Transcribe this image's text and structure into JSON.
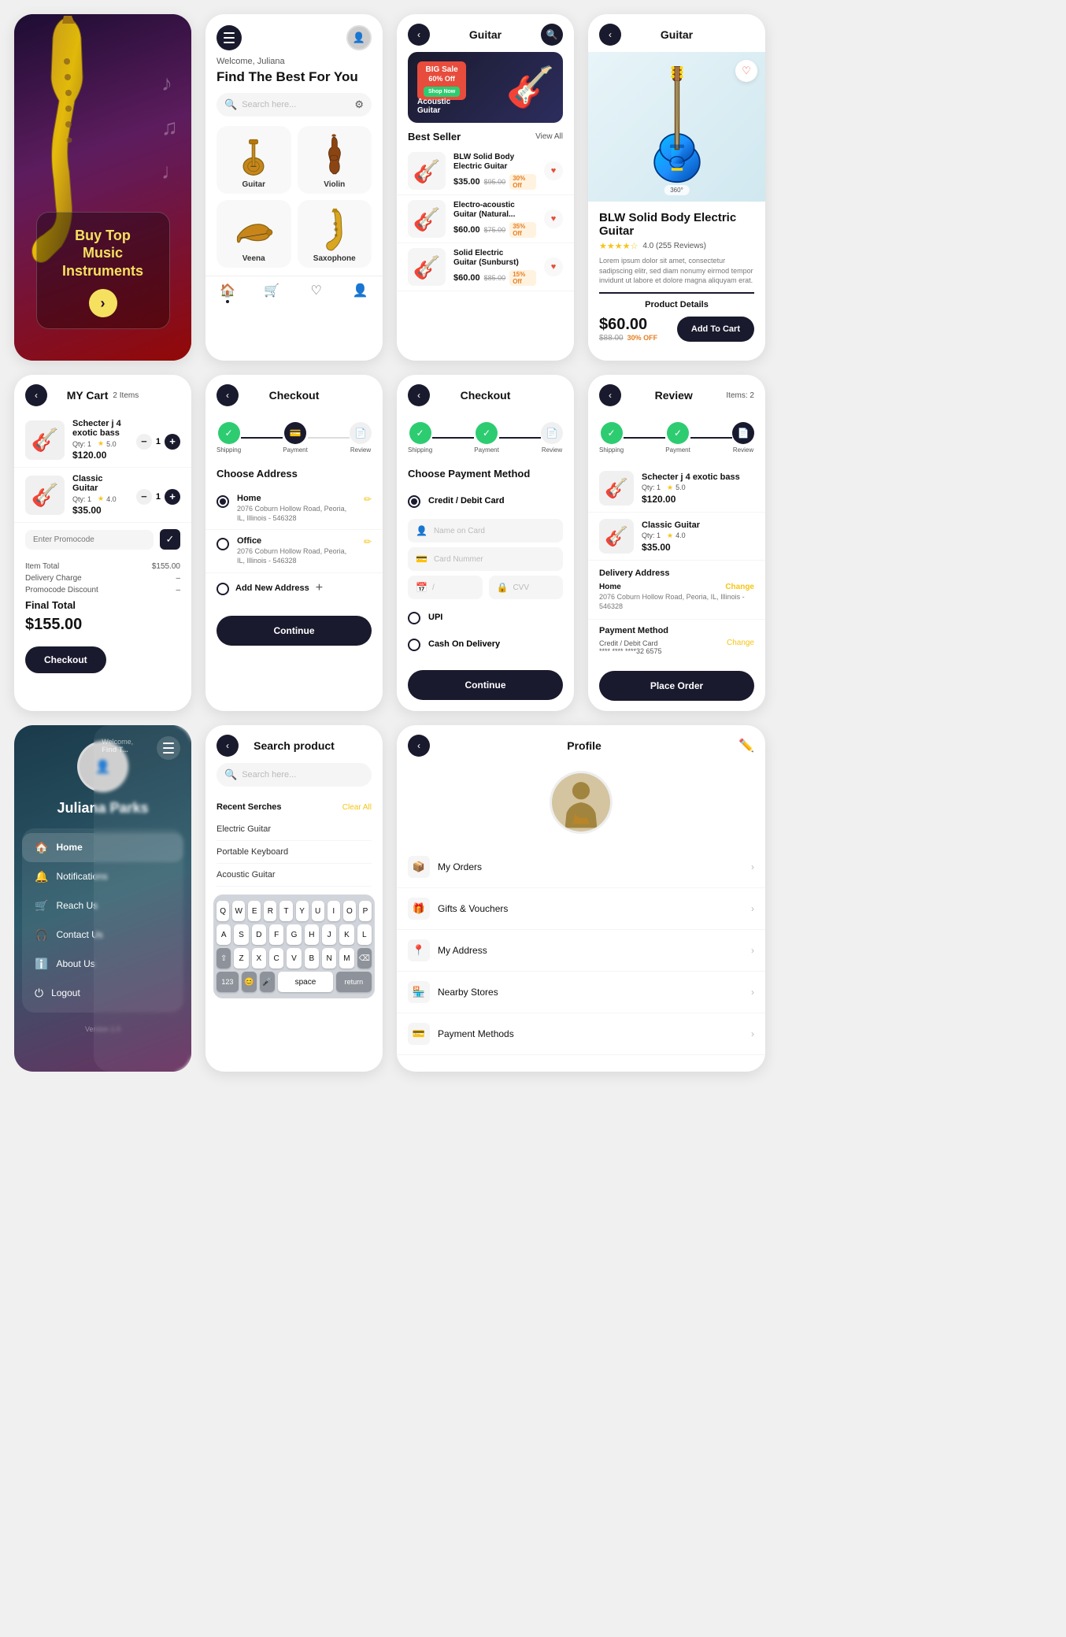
{
  "splash": {
    "title": "Buy Top Music Instruments",
    "btn_arrow": "›",
    "notes": "♪\n♫\n♩"
  },
  "home": {
    "welcome": "Welcome, Juliana",
    "find_text": "Find The Best For You",
    "search_placeholder": "Search here...",
    "categories": [
      {
        "name": "Guitar",
        "icon": "🎸"
      },
      {
        "name": "Violin",
        "icon": "🎻"
      },
      {
        "name": "Veena",
        "icon": "🪕"
      },
      {
        "name": "Saxophone",
        "icon": "🎷"
      }
    ],
    "nav_items": [
      "Home",
      "Cart",
      "Wishlist",
      "Profile"
    ]
  },
  "guitar_list": {
    "title": "Guitar",
    "banner": {
      "sale_text": "BIG Sale\n60% Off",
      "shop_now": "Shop Now",
      "label": "Acoustic\nGuitar"
    },
    "section_title": "Best Seller",
    "view_all": "View All",
    "products": [
      {
        "name": "BLW Solid Body\nElectric Guitar",
        "price": "$35.00",
        "old_price": "$95.00",
        "discount": "30% Off",
        "icon": "🎸"
      },
      {
        "name": "Electro-acoustic\nGuitar (Natural...",
        "price": "$60.00",
        "old_price": "$75.00",
        "discount": "35% Off",
        "icon": "🎸"
      },
      {
        "name": "Solid Electric\nGuitar (Sunburst)",
        "price": "$60.00",
        "old_price": "$85.00",
        "discount": "15% Off",
        "icon": "🎸"
      }
    ]
  },
  "product_detail": {
    "title": "BLW Solid Body Electric Guitar",
    "rating": "4.0",
    "reviews": "255 Reviews",
    "stars": "★★★★☆",
    "description": "Lorem ipsum dolor sit amet, consectetur sadipscing elitr, sed diam nonumy eirmod tempor invidunt ut labore et dolore magna aliquyam erat.",
    "section_label": "Product Details",
    "price": "$60.00",
    "old_price": "$88.00",
    "discount": "30% OFF",
    "rotation": "360°",
    "add_to_cart": "Add To Cart"
  },
  "cart": {
    "title": "MY Cart",
    "items_count": "2 Items",
    "items": [
      {
        "name": "Schecter j 4 exotic bass",
        "qty": 1,
        "rating": "5.0",
        "price": "$120.00",
        "icon": "🎸"
      },
      {
        "name": "Classic Guitar",
        "qty": 1,
        "rating": "4.0",
        "price": "$35.00",
        "icon": "🎸"
      }
    ],
    "promo_placeholder": "Enter Promocode",
    "item_total_label": "Item Total",
    "item_total": "$155.00",
    "delivery_charge_label": "Delivery Charge",
    "delivery_charge": "–",
    "promo_discount_label": "Promocode Discount",
    "promo_discount": "–",
    "final_total_label": "Final Total",
    "final_total": "$155.00",
    "checkout_btn": "Checkout"
  },
  "checkout_address": {
    "title": "Checkout",
    "steps": [
      "Shipping",
      "Payment",
      "Review"
    ],
    "section_label": "Choose Address",
    "addresses": [
      {
        "type": "Home",
        "detail": "2076 Coburn Hollow Road, Peoria, IL, Illinois - 546328",
        "selected": true
      },
      {
        "type": "Office",
        "detail": "2076 Coburn Hollow Road, Peoria, IL, Illinois - 546328",
        "selected": false
      }
    ],
    "add_address": "Add New Address",
    "continue_btn": "Continue"
  },
  "checkout_payment": {
    "title": "Checkout",
    "steps": [
      "Shipping",
      "Payment",
      "Review"
    ],
    "section_label": "Choose Payment Method",
    "options": [
      {
        "label": "Credit / Debit Card",
        "selected": true
      },
      {
        "label": "UPI",
        "selected": false
      },
      {
        "label": "Cash On Delivery",
        "selected": false
      }
    ],
    "fields": {
      "name_placeholder": "Name on Card",
      "card_placeholder": "Card Nummer",
      "expiry_placeholder": "/",
      "cvv_placeholder": "CVV"
    },
    "continue_btn": "Continue"
  },
  "review": {
    "title": "Review",
    "items_count": "Items: 2",
    "items": [
      {
        "name": "Schecter j 4 exotic bass",
        "qty": 1,
        "rating": "5.0",
        "price": "$120.00",
        "icon": "🎸"
      },
      {
        "name": "Classic Guitar",
        "qty": 1,
        "rating": "4.0",
        "price": "$35.00",
        "icon": "🎸"
      }
    ],
    "delivery_title": "Delivery Address",
    "delivery_type": "Home",
    "delivery_change": "Change",
    "delivery_address": "2076 Coburn Hollow Road, Peoria, IL, Illinois - 546328",
    "payment_title": "Payment Method",
    "payment_value": "Credit / Debit Card",
    "payment_card": "**** **** ****32 6575",
    "payment_change": "Change",
    "place_order_btn": "Place Order"
  },
  "sidebar": {
    "name": "Juliana Parks",
    "menu_items": [
      {
        "label": "Home",
        "icon": "🏠",
        "active": true
      },
      {
        "label": "Notifications",
        "icon": "🔔",
        "active": false
      },
      {
        "label": "Reach Us",
        "icon": "🛒",
        "active": false
      },
      {
        "label": "Contact Us",
        "icon": "🎧",
        "active": false
      },
      {
        "label": "About Us",
        "icon": "ℹ️",
        "active": false
      },
      {
        "label": "Logout",
        "icon": "⏻",
        "active": false
      }
    ],
    "version": "Version 1.0",
    "welcome_label": "Welcome,",
    "find_label": "Find T..."
  },
  "search_product": {
    "title": "Search product",
    "search_placeholder": "Search here...",
    "recent_label": "Recent Serches",
    "clear_all": "Clear All",
    "recent_items": [
      "Electric Guitar",
      "Portable Keyboard",
      "Acoustic Guitar"
    ],
    "keyboard": {
      "row1": [
        "Q",
        "W",
        "E",
        "R",
        "T",
        "Y",
        "U",
        "I",
        "O",
        "P"
      ],
      "row2": [
        "A",
        "S",
        "D",
        "F",
        "G",
        "H",
        "J",
        "K",
        "L"
      ],
      "row3": [
        "⇧",
        "Z",
        "X",
        "C",
        "V",
        "B",
        "N",
        "M",
        "⌫"
      ],
      "row4_left": "123",
      "row4_emoji": "😊",
      "row4_mic": "🎤",
      "row4_space": "space",
      "row4_return": "return"
    }
  },
  "profile": {
    "title": "Profile",
    "edit_icon": "✏️",
    "menu_items": [
      {
        "label": "My Orders",
        "icon": "📦"
      },
      {
        "label": "Gifts & Vouchers",
        "icon": "🎁"
      },
      {
        "label": "My Address",
        "icon": "📍"
      },
      {
        "label": "Nearby Stores",
        "icon": "🏪"
      },
      {
        "label": "Payment Methods",
        "icon": "💳"
      }
    ]
  }
}
